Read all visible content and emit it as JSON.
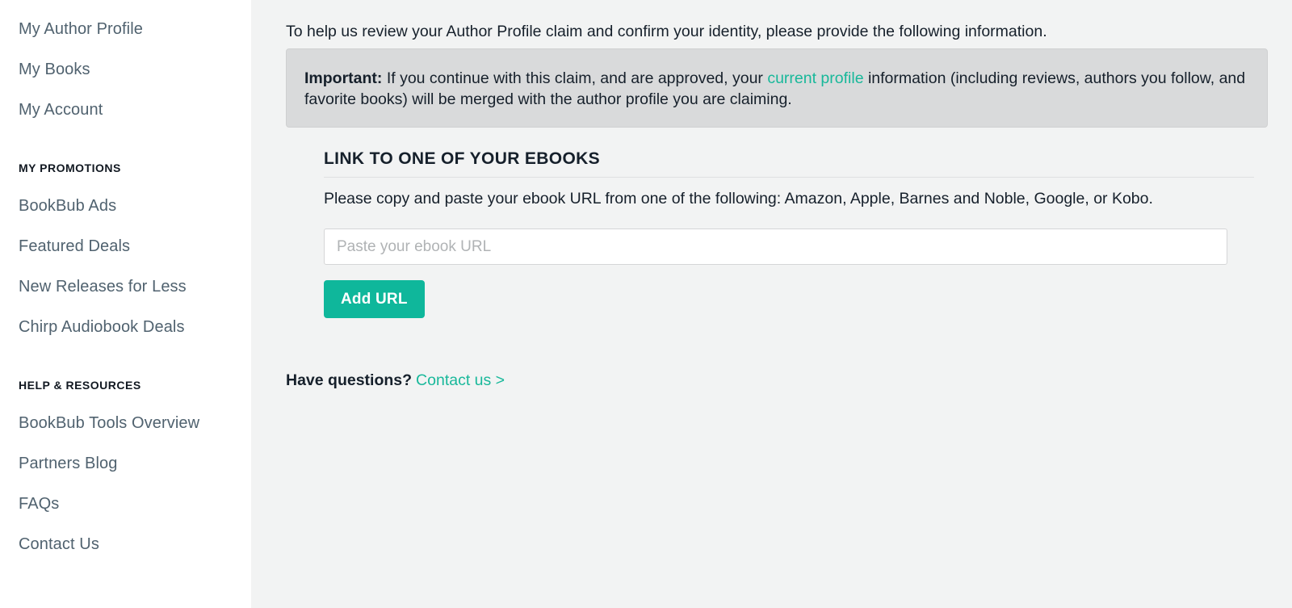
{
  "colors": {
    "accent_teal": "#0fb79b",
    "link_teal": "#18b89a",
    "sidebar_link": "#50626f",
    "main_bg": "#f2f3f3",
    "alert_bg": "#d9dadb",
    "text": "#16202b"
  },
  "sidebar": {
    "account_links": [
      {
        "label": "My Author Profile"
      },
      {
        "label": "My Books"
      },
      {
        "label": "My Account"
      }
    ],
    "promotions_heading": "MY PROMOTIONS",
    "promotions_links": [
      {
        "label": "BookBub Ads"
      },
      {
        "label": "Featured Deals"
      },
      {
        "label": "New Releases for Less"
      },
      {
        "label": "Chirp Audiobook Deals"
      }
    ],
    "help_heading": "HELP & RESOURCES",
    "help_links": [
      {
        "label": "BookBub Tools Overview"
      },
      {
        "label": "Partners Blog"
      },
      {
        "label": "FAQs"
      },
      {
        "label": "Contact Us"
      }
    ]
  },
  "main": {
    "intro": "To help us review your Author Profile claim and confirm your identity, please provide the following information.",
    "alert": {
      "label": "Important:",
      "text_before_link": " If you continue with this claim, and are approved, your ",
      "link_text": "current profile",
      "text_after_link": " information (including reviews, authors you follow, and favorite books) will be merged with the author profile you are claiming."
    },
    "section": {
      "title": "LINK TO ONE OF YOUR EBOOKS",
      "description": "Please copy and paste your ebook URL from one of the following: Amazon, Apple, Barnes and Noble, Google, or Kobo.",
      "input_placeholder": "Paste your ebook URL",
      "input_value": "",
      "submit_label": "Add URL"
    },
    "questions": {
      "label": "Have questions?",
      "link_text": "Contact us >"
    }
  }
}
